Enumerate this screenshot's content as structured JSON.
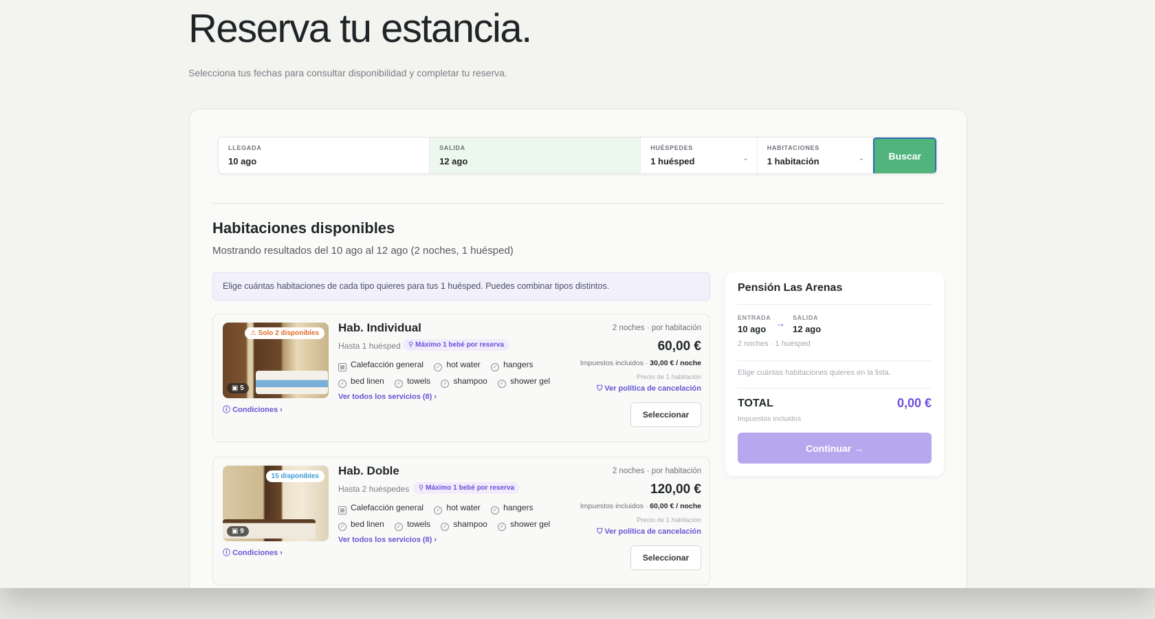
{
  "header": {
    "title": "Reserva tu estancia.",
    "subtitle": "Selecciona tus fechas para consultar disponibilidad y completar tu reserva."
  },
  "search": {
    "arrival_label": "LLEGADA",
    "arrival_value": "10 ago",
    "departure_label": "SALIDA",
    "departure_value": "12 ago",
    "guests_label": "HUÉSPEDES",
    "guests_value": "1 huésped",
    "rooms_label": "HABITACIONES",
    "rooms_value": "1 habitación",
    "button": "Buscar"
  },
  "results": {
    "title": "Habitaciones disponibles",
    "subtitle": "Mostrando resultados del 10 ago al 12 ago (2 noches, 1 huésped)",
    "info": "Elige cuántas habitaciones de cada tipo quieres para tus 1 huésped. Puedes combinar tipos distintos."
  },
  "rooms": [
    {
      "availability": "⚠ Solo 2 disponibles",
      "photos": "5",
      "conditions": "Condiciones",
      "name": "Hab. Individual",
      "capacity": "Hasta 1 huésped",
      "baby_badge": "Máximo 1 bebé por reserva",
      "amenities": [
        "Calefacción general",
        "hot water",
        "hangers",
        "bed linen",
        "towels",
        "shampoo",
        "shower gel"
      ],
      "services_link": "Ver todos los servicios (8)",
      "price_meta": "2 noches · por habitación",
      "price": "60,00 €",
      "tax_note": "Impuestos incluidos · ",
      "per_night": "30,00 € / noche",
      "unit_note": "Precio de 1 habitación",
      "cancel_link": "Ver política de cancelación",
      "select": "Seleccionar"
    },
    {
      "availability": "15 disponibles",
      "photos": "9",
      "conditions": "Condiciones",
      "name": "Hab. Doble",
      "capacity": "Hasta 2 huéspedes",
      "baby_badge": "Máximo 1 bebé por reserva",
      "amenities": [
        "Calefacción general",
        "hot water",
        "hangers",
        "bed linen",
        "towels",
        "shampoo",
        "shower gel"
      ],
      "services_link": "Ver todos los servicios (8)",
      "price_meta": "2 noches · por habitación",
      "price": "120,00 €",
      "tax_note": "Impuestos incluidos · ",
      "per_night": "60,00 € / noche",
      "unit_note": "Precio de 1 habitación",
      "cancel_link": "Ver política de cancelación",
      "select": "Seleccionar"
    }
  ],
  "summary": {
    "hotel": "Pensión Las Arenas",
    "checkin_label": "ENTRADA",
    "checkin_value": "10 ago",
    "checkout_label": "SALIDA",
    "checkout_value": "12 ago",
    "meta": "2 noches · 1 huésped",
    "hint": "Elige cuántas habitaciones quieres en la lista.",
    "total_label": "TOTAL",
    "total_value": "0,00 €",
    "tax": "Impuestos incluidos",
    "continue": "Continuar →"
  },
  "colors": {
    "accent": "#6d4fd8",
    "search_button": "#51b47c",
    "continue_disabled": "#b6a7ef",
    "warn": "#e06a2b",
    "available": "#3b9bd3"
  }
}
